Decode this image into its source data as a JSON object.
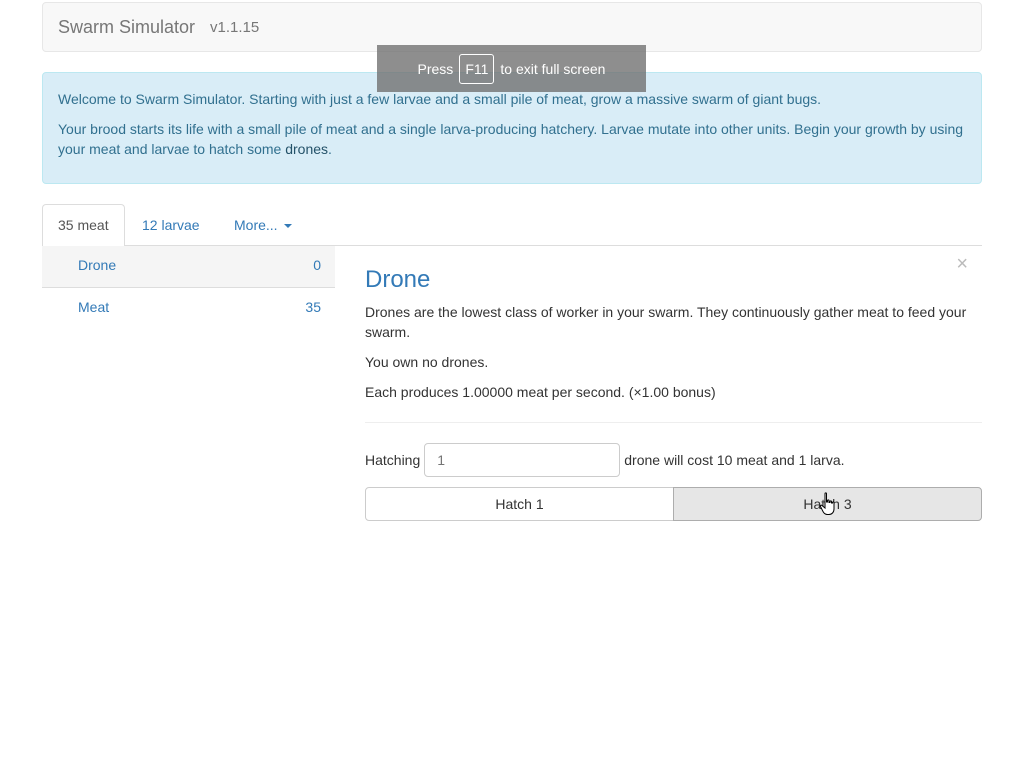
{
  "navbar": {
    "brand": "Swarm Simulator",
    "version": "v1.1.15"
  },
  "fullscreen_notice": {
    "prefix": "Press",
    "key": "F11",
    "suffix": "to exit full screen"
  },
  "alert": {
    "line1": "Welcome to Swarm Simulator. Starting with just a few larvae and a small pile of meat, grow a massive swarm of giant bugs.",
    "line2_text": "Your brood starts its life with a small pile of meat and a single larva-producing hatchery. Larvae mutate into other units. Begin your growth by using your meat and larvae to hatch some",
    "line2_link": "drones",
    "line2_end": "."
  },
  "tabs": [
    {
      "label": "35 meat"
    },
    {
      "label": "12 larvae"
    },
    {
      "label": "More..."
    }
  ],
  "units": [
    {
      "name": "Drone",
      "count": "0"
    },
    {
      "name": "Meat",
      "count": "35"
    }
  ],
  "detail": {
    "title": "Drone",
    "close": "×",
    "description": "Drones are the lowest class of worker in your swarm. They continuously gather meat to feed your swarm.",
    "owned": "You own no drones.",
    "production": "Each produces 1.00000 meat per second. (×1.00 bonus)",
    "hatch_prefix": "Hatching",
    "hatch_placeholder": "1",
    "hatch_suffix": "drone will cost 10 meat and 1 larva.",
    "buttons": [
      "Hatch 1",
      "Hatch 3"
    ]
  },
  "colors": {
    "link": "#337ab7",
    "alert_bg": "#d9edf7",
    "alert_text": "#31708f"
  }
}
